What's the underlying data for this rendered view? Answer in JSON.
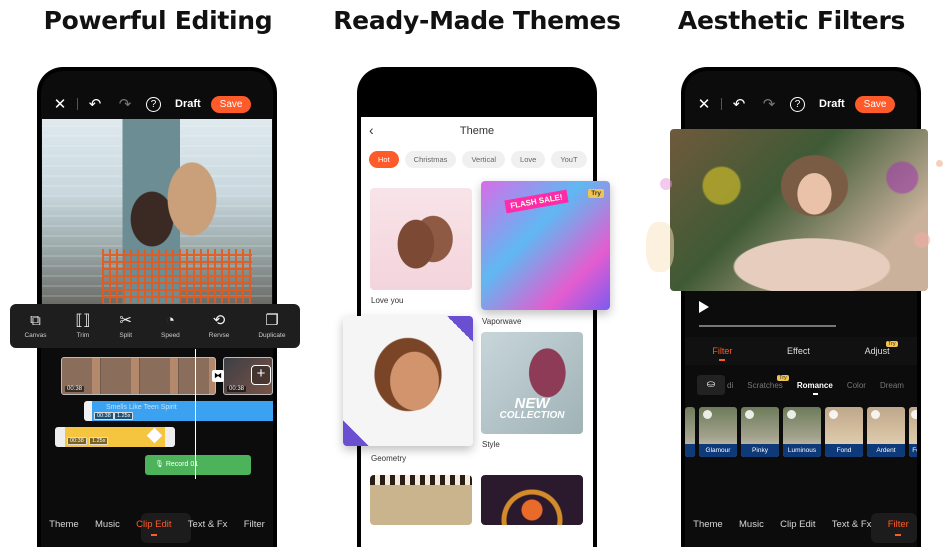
{
  "panels": [
    {
      "headline": "Powerful Editing"
    },
    {
      "headline": "Ready-Made Themes"
    },
    {
      "headline": "Aesthetic Filters"
    }
  ],
  "editor": {
    "draft_label": "Draft",
    "save_label": "Save",
    "tools": [
      {
        "icon": "canvas-icon",
        "glyph": "⧉",
        "label": "Canvas"
      },
      {
        "icon": "trim-icon",
        "glyph": "⟦⟧",
        "label": "Trim"
      },
      {
        "icon": "scissors-icon",
        "glyph": "✂",
        "label": "Split"
      },
      {
        "icon": "speed-icon",
        "glyph": "◔",
        "label": "Speed"
      },
      {
        "icon": "reverse-icon",
        "glyph": "⟲",
        "label": "Rervse"
      },
      {
        "icon": "duplicate-icon",
        "glyph": "❐",
        "label": "Duplicate"
      }
    ],
    "timeline": {
      "clip1_duration": "00:38",
      "clip2_duration": "00:38",
      "audio_name": "Smells Like Teen Spirit",
      "audio_duration": "00:38",
      "audio_speed": "1.25x",
      "sticker_duration": "00:38",
      "sticker_speed": "1.25x",
      "record_label": "Record 01"
    },
    "bottom_tabs": [
      {
        "label": "Theme",
        "active": false
      },
      {
        "label": "Music",
        "active": false
      },
      {
        "label": "Clip Edit",
        "active": true
      },
      {
        "label": "Text & Fx",
        "active": false
      },
      {
        "label": "Filter",
        "active": false
      }
    ]
  },
  "themes": {
    "title": "Theme",
    "chips": [
      {
        "label": "Hot",
        "active": true
      },
      {
        "label": "Christmas",
        "active": false
      },
      {
        "label": "Vertical",
        "active": false
      },
      {
        "label": "Love",
        "active": false
      },
      {
        "label": "YouT",
        "active": false
      }
    ],
    "cards": [
      {
        "label": "Love you"
      },
      {
        "label": "Vaporwave",
        "badge": "Try",
        "overlay": "FLASH SALE!"
      },
      {
        "label": "Geometry"
      },
      {
        "label": "Style",
        "overlay_line1": "NEW",
        "overlay_line2": "COLLECTION"
      }
    ]
  },
  "filters": {
    "draft_label": "Draft",
    "save_label": "Save",
    "tabs": [
      {
        "label": "Filter",
        "active": true
      },
      {
        "label": "Effect",
        "active": false
      },
      {
        "label": "Adjust",
        "active": false,
        "badge": "Try"
      }
    ],
    "categories": [
      {
        "label": "di",
        "active": false
      },
      {
        "label": "Scratches",
        "active": false,
        "badge": "Try"
      },
      {
        "label": "Romance",
        "active": true
      },
      {
        "label": "Color",
        "active": false
      },
      {
        "label": "Dream",
        "active": false
      }
    ],
    "presets": [
      "Glamour",
      "Pinky",
      "Luminous",
      "Fond",
      "Ardent",
      "Fe"
    ],
    "bottom_tabs": [
      {
        "label": "Theme",
        "active": false
      },
      {
        "label": "Music",
        "active": false
      },
      {
        "label": "Clip Edit",
        "active": false
      },
      {
        "label": "Text & Fx",
        "active": false
      },
      {
        "label": "Filter",
        "active": true
      }
    ]
  },
  "colors": {
    "accent": "#ff5a2a",
    "audio": "#3aa2f0",
    "sticker": "#f6c53f",
    "record": "#4cb35a",
    "filter_label": "#0e3a79"
  }
}
